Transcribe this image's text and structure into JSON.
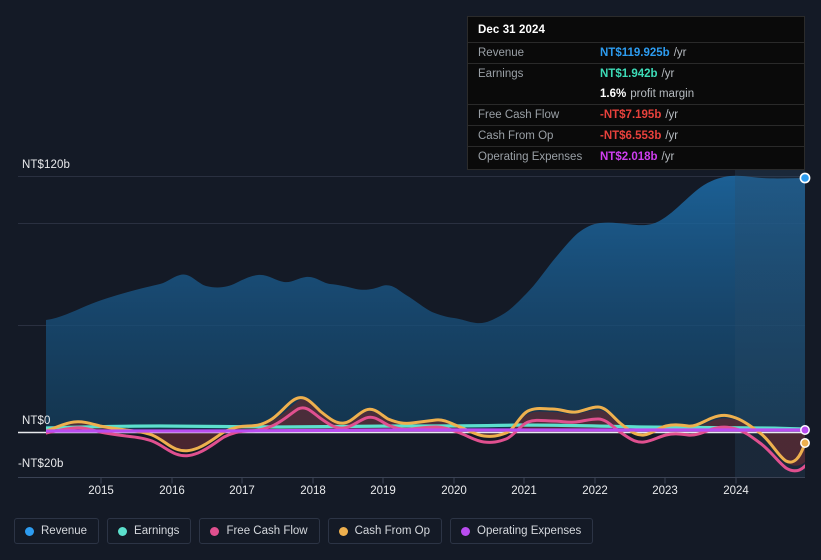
{
  "chart_data": {
    "type": "area",
    "title": "",
    "xlabel": "",
    "ylabel": "",
    "ylim": [
      -20,
      120
    ],
    "grid": true,
    "legend_position": "bottom",
    "y_ticks": [
      "NT$120b",
      "NT$0",
      "-NT$20b"
    ],
    "y_tick_values": [
      120,
      0,
      -20
    ],
    "x_ticks": [
      "2015",
      "2016",
      "2017",
      "2018",
      "2019",
      "2020",
      "2021",
      "2022",
      "2023",
      "2024"
    ],
    "x": [
      2014.3,
      2014.8,
      2015.3,
      2015.8,
      2016.3,
      2016.8,
      2017.3,
      2017.8,
      2018.3,
      2018.8,
      2019.3,
      2019.8,
      2020.3,
      2020.8,
      2021.3,
      2021.8,
      2022.3,
      2022.8,
      2023.3,
      2023.8,
      2024.3,
      2024.9
    ],
    "series": [
      {
        "name": "Revenue",
        "color": "#2d9cf0",
        "values": [
          52,
          56,
          62,
          66,
          70,
          73,
          76,
          74,
          76,
          78,
          76,
          72,
          68,
          66,
          72,
          86,
          98,
          100,
          104,
          112,
          118,
          119.925
        ]
      },
      {
        "name": "Earnings",
        "color": "#5ce0cd",
        "values": [
          2.2,
          2.3,
          2.4,
          2.3,
          2.2,
          2.5,
          2.6,
          2.5,
          2.6,
          2.6,
          2.5,
          2.4,
          2.3,
          2.4,
          2.6,
          2.7,
          2.6,
          2.5,
          2.4,
          2.2,
          2.0,
          1.942
        ]
      },
      {
        "name": "Free Cash Flow",
        "color": "#e0508f",
        "values": [
          -0.5,
          0.5,
          0.2,
          -2.5,
          -4.5,
          2.0,
          6.0,
          2.5,
          0.5,
          -0.5,
          1.0,
          -4.5,
          -5.0,
          7.5,
          6.5,
          8.0,
          -1.5,
          2.5,
          -1.0,
          3.5,
          1.0,
          -7.195
        ]
      },
      {
        "name": "Cash From Op",
        "color": "#eeb04e",
        "values": [
          0.5,
          2.0,
          1.8,
          -1.5,
          -3.5,
          3.0,
          10.0,
          4.0,
          2.0,
          1.0,
          3.0,
          -3.5,
          -4.0,
          8.5,
          7.5,
          9.0,
          -0.5,
          3.5,
          0.5,
          4.5,
          2.0,
          -6.553
        ]
      },
      {
        "name": "Operating Expenses",
        "color": "#b94cf0",
        "values": [
          1.4,
          1.4,
          1.4,
          1.4,
          1.4,
          1.4,
          1.5,
          1.5,
          1.5,
          1.5,
          1.6,
          1.6,
          1.7,
          1.8,
          1.9,
          1.9,
          2.0,
          2.0,
          2.0,
          2.0,
          2.0,
          2.018
        ]
      }
    ]
  },
  "tooltip": {
    "date": "Dec 31 2024",
    "rows": [
      {
        "label": "Revenue",
        "value": "NT$119.925b",
        "unit": "/yr",
        "color": "#2d9cf0"
      },
      {
        "label": "Earnings",
        "value": "NT$1.942b",
        "unit": "/yr",
        "color": "#3ddcb8"
      },
      {
        "label": "",
        "value": "1.6%",
        "unit": "profit margin",
        "color": "#ffffff"
      },
      {
        "label": "Free Cash Flow",
        "value": "-NT$7.195b",
        "unit": "/yr",
        "color": "#e8413c"
      },
      {
        "label": "Cash From Op",
        "value": "-NT$6.553b",
        "unit": "/yr",
        "color": "#e8413c"
      },
      {
        "label": "Operating Expenses",
        "value": "NT$2.018b",
        "unit": "/yr",
        "color": "#cf3ef0"
      }
    ]
  },
  "legend": {
    "items": [
      {
        "label": "Revenue",
        "color": "#2d9cf0"
      },
      {
        "label": "Earnings",
        "color": "#5ce0cd"
      },
      {
        "label": "Free Cash Flow",
        "color": "#e0508f"
      },
      {
        "label": "Cash From Op",
        "color": "#eeb04e"
      },
      {
        "label": "Operating Expenses",
        "color": "#b94cf0"
      }
    ]
  }
}
